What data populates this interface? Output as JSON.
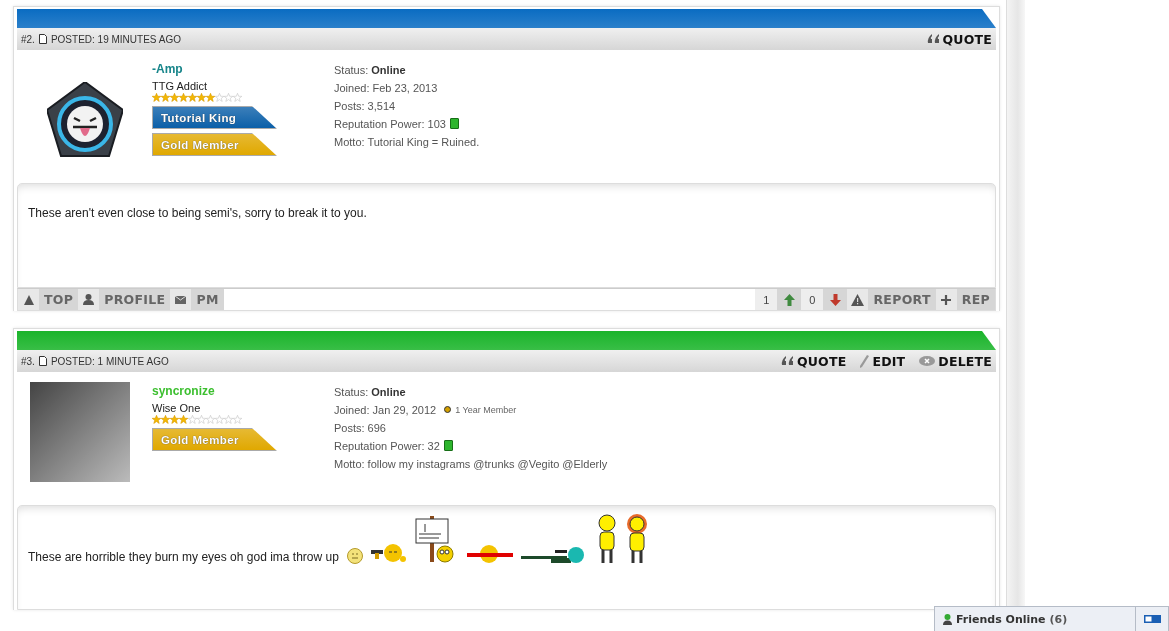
{
  "posts": [
    {
      "number": "#2.",
      "posted": "POSTED: 19 MINUTES AGO",
      "color": "#0a6cc2",
      "actions": [
        {
          "kind": "quote",
          "label": "QUOTE"
        }
      ],
      "user": {
        "avatar": {
          "kind": "emblem"
        },
        "name": "-Amp",
        "color": "#17858a",
        "rank": "TTG Addict",
        "stars": 7,
        "badges": [
          {
            "label": "Tutorial King",
            "color": "#0b5fa8"
          },
          {
            "label": "Gold Member",
            "color": "#e0a800"
          }
        ],
        "stats": [
          {
            "kind": "status",
            "text": "Status: **Online**"
          },
          {
            "kind": "joined",
            "text": "Joined: Feb 23, 2013"
          },
          {
            "kind": "posts",
            "text": "Posts: 3,514"
          },
          {
            "kind": "rep",
            "text": "Reputation Power: 103"
          },
          {
            "kind": "motto",
            "text": "Motto: Tutorial King = Ruined."
          }
        ]
      },
      "body": {
        "text": "These aren't even close to being semi's, sorry to break it to you."
      },
      "footer": {
        "left": [
          {
            "kind": "top",
            "label": "TOP"
          },
          {
            "kind": "profile",
            "label": "PROFILE"
          },
          {
            "kind": "pm",
            "label": "PM"
          }
        ],
        "up": "1",
        "down": "0",
        "right": [
          {
            "kind": "report",
            "label": "REPORT"
          },
          {
            "kind": "rep",
            "label": "REP"
          }
        ]
      }
    },
    {
      "number": "#3.",
      "posted": "POSTED: 1 MINUTE AGO",
      "color": "#1ab42a",
      "actions": [
        {
          "kind": "quote",
          "label": "QUOTE"
        },
        {
          "kind": "edit",
          "label": "EDIT"
        },
        {
          "kind": "delete",
          "label": "DELETE"
        }
      ],
      "user": {
        "avatar": {
          "kind": "image"
        },
        "name": "syncronize",
        "color": "#3cbf2f",
        "rank": "Wise One",
        "stars": 4,
        "badges": [
          {
            "label": "Gold Member",
            "color": "#e0a800"
          }
        ],
        "stats": [
          {
            "kind": "status",
            "text": "Status: **Online**"
          },
          {
            "kind": "joined",
            "text": "Joined: Jan 29, 2012",
            "member": "1 Year Member"
          },
          {
            "kind": "posts",
            "text": "Posts: 696"
          },
          {
            "kind": "rep",
            "text": "Reputation Power: 32"
          },
          {
            "kind": "motto",
            "text": "Motto: follow my instagrams @trunks @Vegito @Elderly"
          }
        ]
      },
      "body": {
        "text": "These are horrible they burn my eyes oh god ima throw up",
        "emoticons": [
          {
            "kind": "neutral"
          },
          {
            "kind": "gun"
          },
          {
            "kind": "sign"
          },
          {
            "kind": "censored"
          },
          {
            "kind": "sniper"
          },
          {
            "kind": "couple"
          }
        ]
      }
    }
  ],
  "friends_bar": {
    "label": "Friends Online",
    "count": "(6)"
  }
}
